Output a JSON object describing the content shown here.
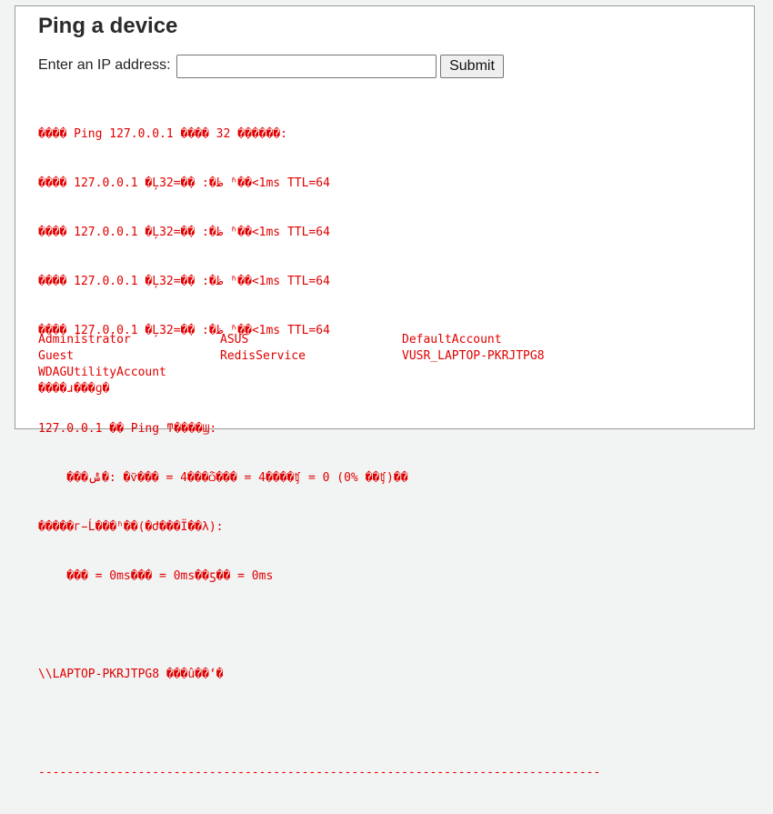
{
  "page": {
    "title": "Ping a device",
    "form": {
      "label": "Enter an IP address:",
      "input_value": "",
      "submit_label": "Submit"
    }
  },
  "output": {
    "lines": [
      "���� Ping 127.0.0.1 ���� 32 �ֽ�����:",
      "���� 127.0.0.1 �Ļظ�: �ֽ�=32 ʱ��<1ms TTL=64",
      "���� 127.0.0.1 �Ļظ�: �ֽ�=32 ʱ��<1ms TTL=64",
      "���� 127.0.0.1 �Ļظ�: �ֽ�=32 ʱ��<1ms TTL=64",
      "���� 127.0.0.1 �Ļظ�: �ֽ�=32 ʱ��<1ms TTL=64",
      "",
      "127.0.0.1 �� Ping ͳ����Ϣ:",
      "    ���ݰ�: �ѷ��� = 4���ѽ��� = 4����ʧ = 0 (0% ��ʧ)��",
      "�����г̵Ĺ���ʱ��(�Ժ���Ϊ��λ):",
      "    ��� = 0ms��� = 0ms��ƽ�� = 0ms",
      "",
      "\\\\LAPTOP-PKRJTPG8 ���û��ʻ�",
      "",
      "-------------------------------------------------------------------------------"
    ],
    "accounts": [
      [
        "Administrator",
        "ASUS",
        "DefaultAccount"
      ],
      [
        "Guest",
        "RedisService",
        "VUSR_LAPTOP-PKRJTPG8"
      ],
      [
        "WDAGUtilityAccount",
        "",
        ""
      ]
    ],
    "footer": "����ɹ���ɡ�"
  }
}
